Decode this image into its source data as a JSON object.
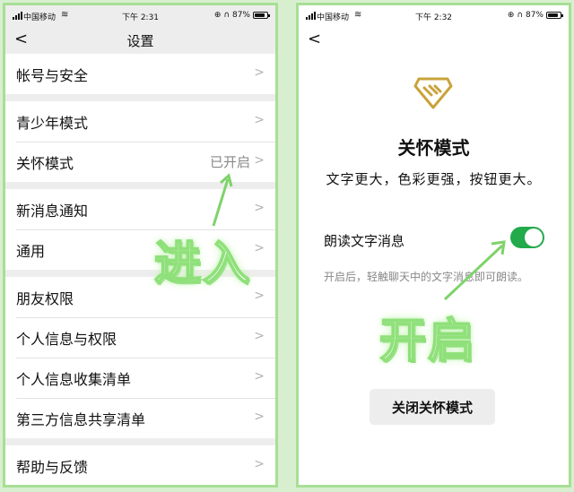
{
  "left": {
    "status": {
      "carrier": "中国移动",
      "time": "下午 2:31",
      "battery": "87%"
    },
    "title": "设置",
    "groups": [
      [
        "帐号与安全"
      ],
      [
        "青少年模式",
        "关怀模式"
      ],
      [
        "新消息通知",
        "通用"
      ],
      [
        "朋友权限",
        "个人信息与权限",
        "个人信息收集清单",
        "第三方信息共享清单"
      ],
      [
        "帮助与反馈"
      ]
    ],
    "care_mode_value": "已开启",
    "overlay": "进入"
  },
  "right": {
    "status": {
      "carrier": "中国移动",
      "time": "下午 2:32",
      "battery": "87%"
    },
    "title": "关怀模式",
    "subtitle": "文字更大，色彩更强，按钮更大。",
    "setting_label": "朗读文字消息",
    "toggle_on": true,
    "setting_desc": "开启后，轻触聊天中的文字消息即可朗读。",
    "close_button": "关闭关怀模式",
    "overlay": "开启"
  },
  "colors": {
    "toggle": "#22aa4b",
    "logo": "#c9a23a",
    "overlay_glow": "#8fe07a",
    "frame": "#a8df96"
  },
  "icons": {
    "back": "chevron-left-icon",
    "row": "chevron-right-icon",
    "logo": "care-hand-heart-icon"
  }
}
